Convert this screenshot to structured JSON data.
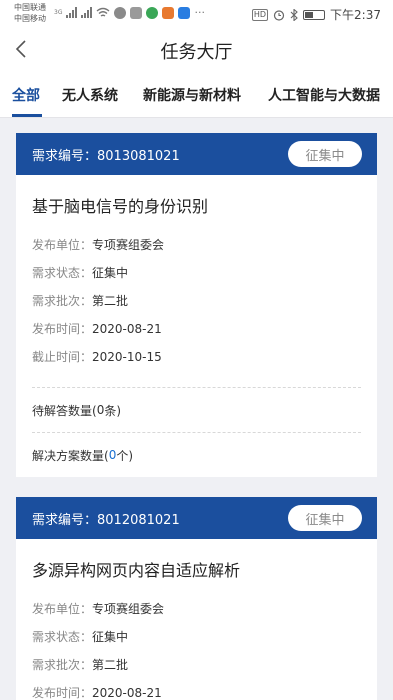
{
  "status_bar": {
    "carrier_1": "中国联通",
    "carrier_2": "中国移动",
    "network_label": "3G",
    "hd_label": "HD",
    "time": "下午2:37"
  },
  "nav": {
    "title": "任务大厅"
  },
  "tabs": [
    "全部",
    "无人系统",
    "新能源与新材料",
    "人工智能与大数据"
  ],
  "active_tab": 0,
  "labels": {
    "code_prefix": "需求编号：",
    "publisher": "发布单位：",
    "status": "需求状态：",
    "batch": "需求批次：",
    "publish_time": "发布时间：",
    "deadline": "截止时间：",
    "pending_prefix": "待解答数量(",
    "pending_suffix": "条)",
    "solutions_prefix": "解决方案数量(",
    "solutions_suffix": "个)"
  },
  "cards": [
    {
      "code": "8013081021",
      "badge": "征集中",
      "title": "基于脑电信号的身份识别",
      "publisher": "专项赛组委会",
      "status": "征集中",
      "batch": "第二批",
      "publish_time": "2020-08-21",
      "deadline": "2020-10-15",
      "pending_count": "0",
      "solutions_count": "0"
    },
    {
      "code": "8012081021",
      "badge": "征集中",
      "title": "多源异构网页内容自适应解析",
      "publisher": "专项赛组委会",
      "status": "征集中",
      "batch": "第二批",
      "publish_time": "2020-08-21"
    }
  ],
  "colors": {
    "brand_blue": "#1b4f9e",
    "link_blue": "#1a6fd0",
    "background": "#eff0f4"
  }
}
